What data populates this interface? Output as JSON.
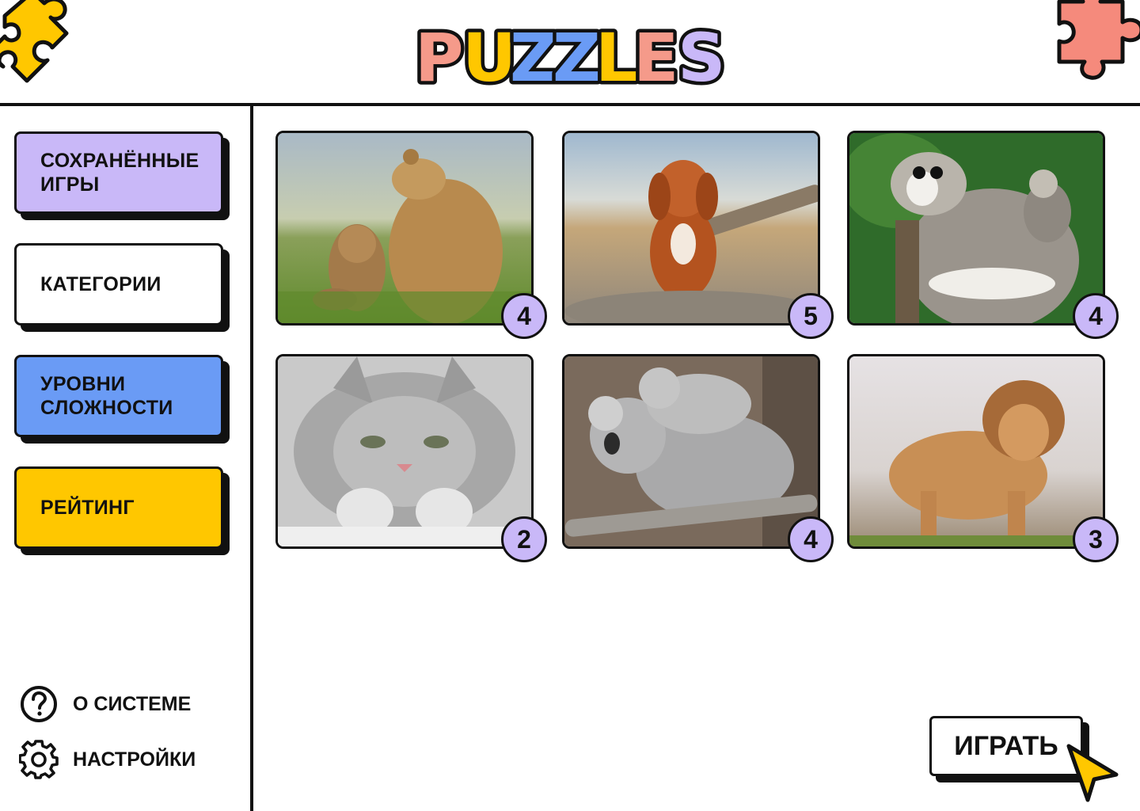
{
  "app": {
    "logo_text": "PUZZLES",
    "logo_colors": [
      "#f59a8a",
      "#ffc700",
      "#6a9bf5",
      "#c9b8f8"
    ]
  },
  "sidebar": {
    "items": [
      {
        "label": "СОХРАНЁННЫЕ ИГРЫ",
        "color": "#c9b8f8"
      },
      {
        "label": "КАТЕГОРИИ",
        "color": "#ffffff"
      },
      {
        "label": "УРОВНИ СЛОЖНОСТИ",
        "color": "#6a9bf5"
      },
      {
        "label": "РЕЙТИНГ",
        "color": "#ffc700"
      }
    ],
    "about_label": "О СИСТЕМЕ",
    "settings_label": "НАСТРОЙКИ"
  },
  "puzzles": [
    {
      "animal": "bear",
      "icon": "bear-image",
      "rating": "4"
    },
    {
      "animal": "dog",
      "icon": "dog-image",
      "rating": "5"
    },
    {
      "animal": "lemur",
      "icon": "lemur-image",
      "rating": "4"
    },
    {
      "animal": "cat",
      "icon": "cat-image",
      "rating": "2"
    },
    {
      "animal": "koala",
      "icon": "koala-image",
      "rating": "4"
    },
    {
      "animal": "lion",
      "icon": "lion-image",
      "rating": "3"
    }
  ],
  "play_label": "ИГРАТЬ",
  "accent_colors": {
    "purple": "#c9b8f8",
    "blue": "#6a9bf5",
    "yellow": "#ffc700",
    "coral": "#f58a7c"
  }
}
